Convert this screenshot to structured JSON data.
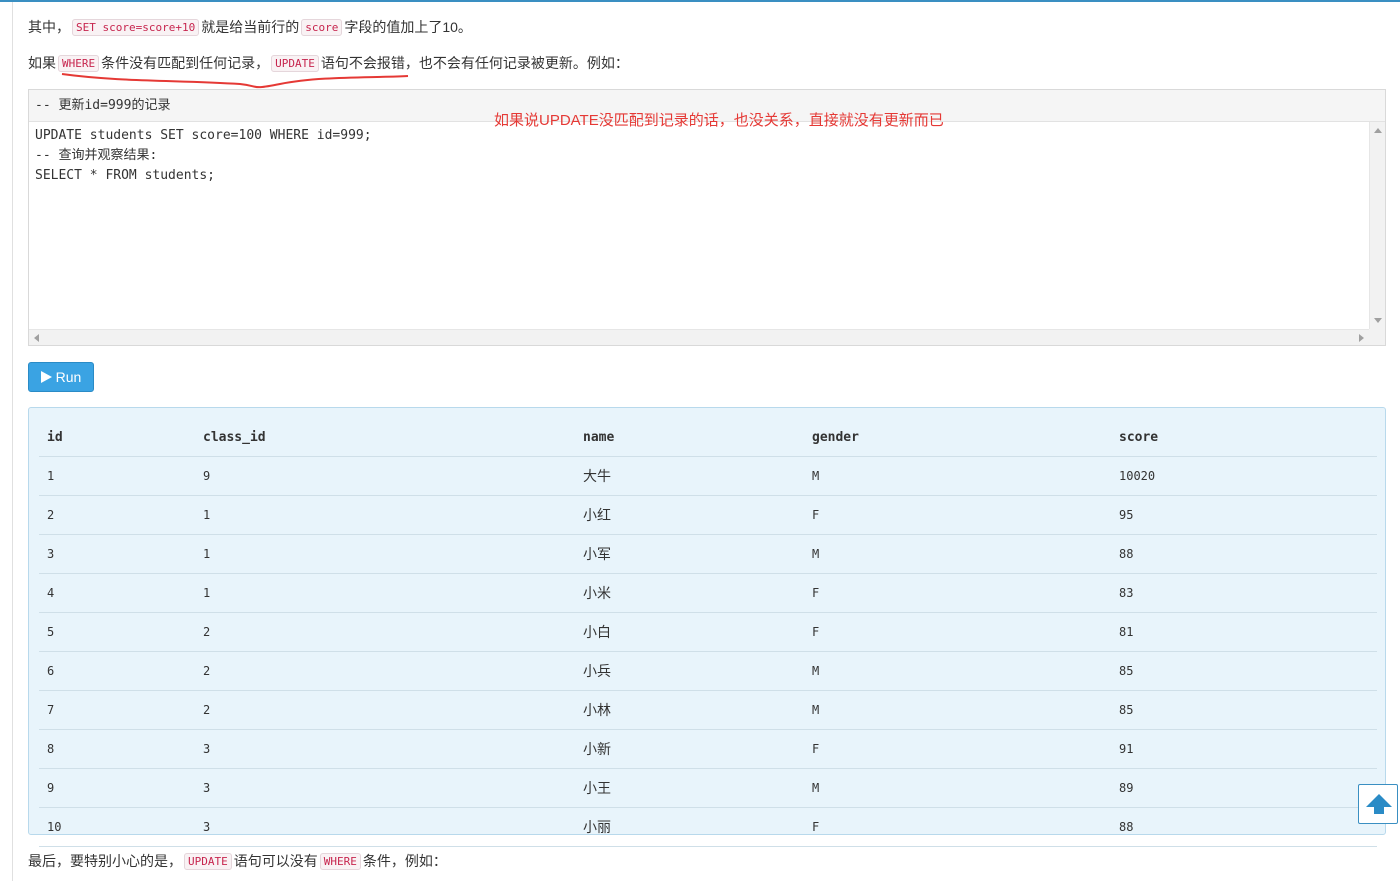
{
  "para1": {
    "pre": "其中，",
    "code1": "SET score=score+10",
    "mid": "就是给当前行的",
    "code2": "score",
    "post": "字段的值加上了10。"
  },
  "para2": {
    "pre": "如果",
    "code1": "WHERE",
    "mid": "条件没有匹配到任何记录，",
    "code2": "UPDATE",
    "post": "语句不会报错，也不会有任何记录被更新。例如："
  },
  "editor": {
    "header": "-- 更新id=999的记录",
    "code": "UPDATE students SET score=100 WHERE id=999;\n-- 查询并观察结果:\nSELECT * FROM students;"
  },
  "annotation": "如果说UPDATE没匹配到记录的话，也没关系，直接就没有更新而已",
  "run_button": {
    "label": "Run"
  },
  "table": {
    "columns": [
      "id",
      "class_id",
      "name",
      "gender",
      "score"
    ],
    "rows": [
      [
        "1",
        "9",
        "大牛",
        "M",
        "10020"
      ],
      [
        "2",
        "1",
        "小红",
        "F",
        "95"
      ],
      [
        "3",
        "1",
        "小军",
        "M",
        "88"
      ],
      [
        "4",
        "1",
        "小米",
        "F",
        "83"
      ],
      [
        "5",
        "2",
        "小白",
        "F",
        "81"
      ],
      [
        "6",
        "2",
        "小兵",
        "M",
        "85"
      ],
      [
        "7",
        "2",
        "小林",
        "M",
        "85"
      ],
      [
        "8",
        "3",
        "小新",
        "F",
        "91"
      ],
      [
        "9",
        "3",
        "小王",
        "M",
        "89"
      ],
      [
        "10",
        "3",
        "小丽",
        "F",
        "88"
      ]
    ]
  },
  "para3": {
    "pre": "最后，要特别小心的是，",
    "code1": "UPDATE",
    "mid": "语句可以没有",
    "code2": "WHERE",
    "post": "条件，例如："
  },
  "colors": {
    "accent": "#3aa3e3",
    "annotation": "#e53935",
    "result_bg": "#e8f4fb"
  },
  "icons": {
    "run": "play-icon",
    "back_to_top": "arrow-up-icon"
  }
}
